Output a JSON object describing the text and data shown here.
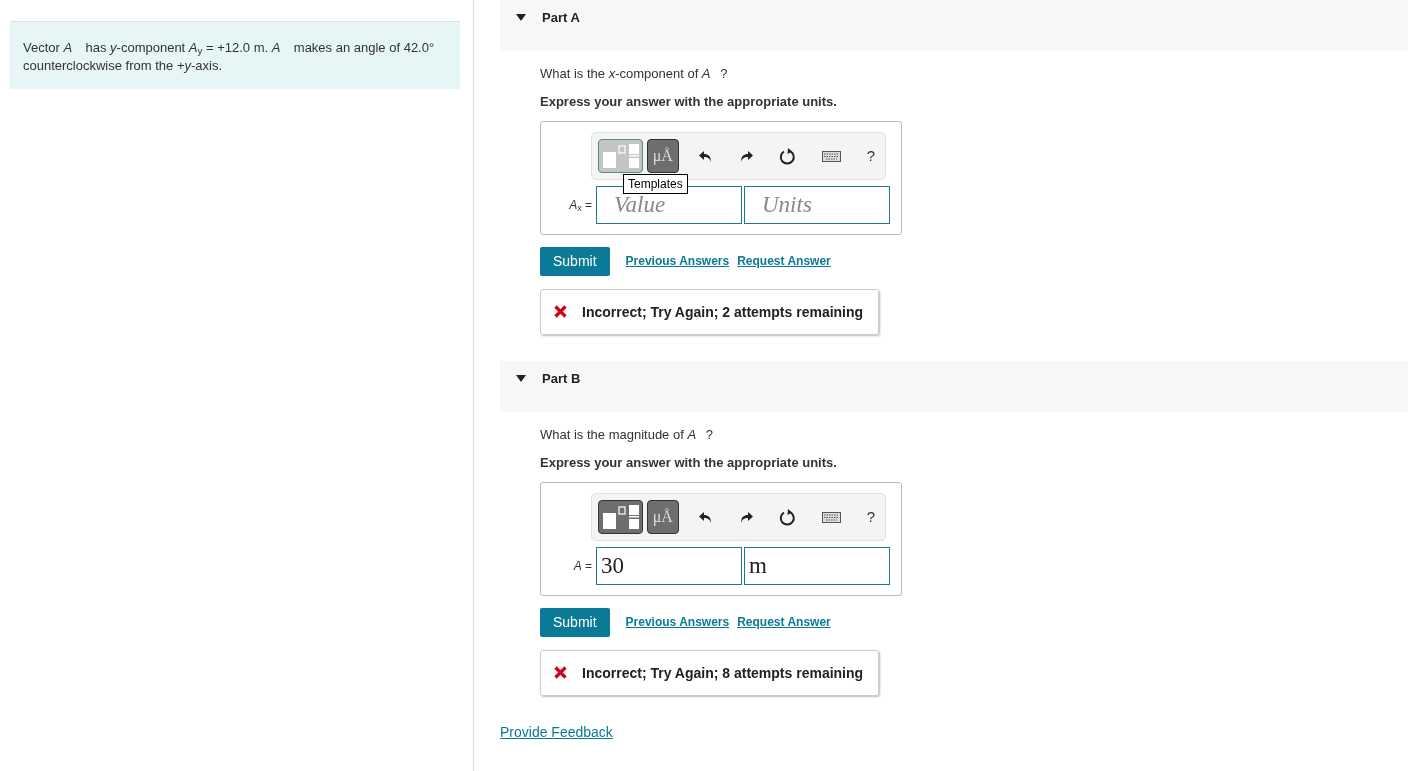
{
  "problem": {
    "text": "Vector *A⃗* has *y*-component *A*$_{y}$ = +12.0 m. *A⃗* makes an angle of 42.0° counterclockwise from the +*y*-axis."
  },
  "parts": [
    {
      "label": "Part A",
      "expanded": true,
      "question": "What is the *x*-component of *A⃗*?",
      "instruction": "Express your answer with the appropriate units.",
      "toolbar": {
        "templates_hovered": true,
        "units_label": "μÅ",
        "help": "?",
        "tooltip": "Templates"
      },
      "answer_label": "*A*$_{x}$ =",
      "value": {
        "placeholder": "Value"
      },
      "units": {
        "placeholder": "Units"
      },
      "submit": "Submit",
      "links": [
        "Previous Answers",
        "Request Answer"
      ],
      "feedback": {
        "kind": "incorrect",
        "text": "Incorrect; Try Again; 2 attempts remaining"
      }
    },
    {
      "label": "Part B",
      "expanded": true,
      "question": "What is the magnitude of *A⃗*?",
      "instruction": "Express your answer with the appropriate units.",
      "toolbar": {
        "templates_hovered": false,
        "units_label": "μÅ",
        "help": "?"
      },
      "answer_label": "*A* =",
      "value": {
        "value": "30"
      },
      "units": {
        "value": "m"
      },
      "submit": "Submit",
      "links": [
        "Previous Answers",
        "Request Answer"
      ],
      "feedback": {
        "kind": "incorrect",
        "text": "Incorrect; Try Again; 8 attempts remaining"
      }
    }
  ],
  "footer_link": "Provide Feedback"
}
